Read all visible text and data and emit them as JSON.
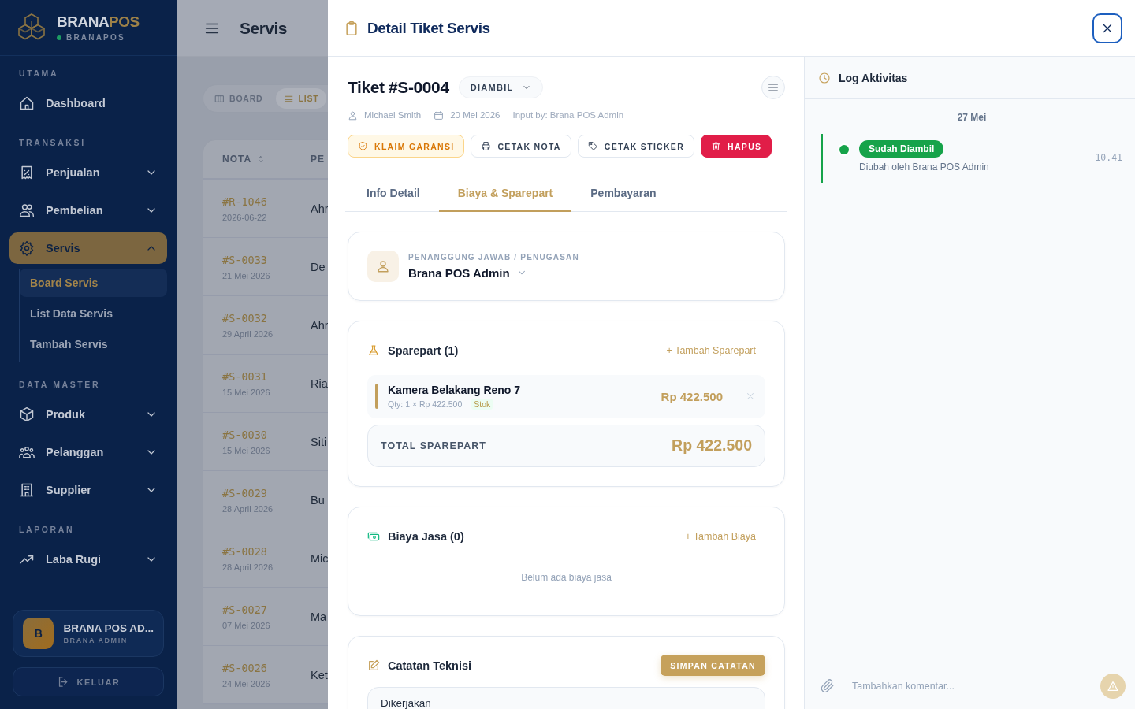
{
  "sidebar": {
    "brand": {
      "name": "BRANA",
      "accent": "POS",
      "subtitle": "BRANAPOS"
    },
    "sections": [
      {
        "label": "UTAMA",
        "items": [
          {
            "label": "Dashboard",
            "selected": false
          }
        ]
      },
      {
        "label": "TRANSAKSI",
        "items": [
          {
            "label": "Penjualan",
            "selected": false,
            "expanded": false
          },
          {
            "label": "Pembelian",
            "selected": false,
            "expanded": false
          },
          {
            "label": "Servis",
            "selected": true,
            "expanded": true,
            "children": [
              {
                "label": "Board Servis",
                "selected": true
              },
              {
                "label": "List Data Servis",
                "selected": false
              },
              {
                "label": "Tambah Servis",
                "selected": false
              }
            ]
          }
        ]
      },
      {
        "label": "DATA MASTER",
        "items": [
          {
            "label": "Produk",
            "selected": false,
            "expanded": false
          },
          {
            "label": "Pelanggan",
            "selected": false,
            "expanded": false
          },
          {
            "label": "Supplier",
            "selected": false,
            "expanded": false
          }
        ]
      },
      {
        "label": "LAPORAN",
        "items": [
          {
            "label": "Laba Rugi",
            "selected": false,
            "expanded": false
          }
        ]
      }
    ],
    "user": {
      "initial": "B",
      "name": "BRANA POS AD...",
      "role": "BRANA ADMIN"
    },
    "logout": "KELUAR"
  },
  "main": {
    "title": "Servis",
    "view_toggle": [
      {
        "label": "BOARD",
        "selected": false
      },
      {
        "label": "LIST",
        "selected": true
      }
    ],
    "table": {
      "columns": [
        "NOTA",
        "PE"
      ],
      "rows": [
        {
          "nota": "#R-1046",
          "date": "2026-06-22",
          "column_2": "Ahr"
        },
        {
          "nota": "#S-0033",
          "date": "21 Mei 2026",
          "column_2": "De"
        },
        {
          "nota": "#S-0032",
          "date": "29 April 2026",
          "column_2": "Ahr"
        },
        {
          "nota": "#S-0031",
          "date": "15 Mei 2026",
          "column_2": "Ria"
        },
        {
          "nota": "#S-0030",
          "date": "15 Mei 2026",
          "column_2": "Siti"
        },
        {
          "nota": "#S-0029",
          "date": "28 April 2026",
          "column_2": "Bu"
        },
        {
          "nota": "#S-0028",
          "date": "28 April 2026",
          "column_2": "Mic"
        },
        {
          "nota": "#S-0027",
          "date": "07 Mei 2026",
          "column_2": "Ma"
        },
        {
          "nota": "#S-0026",
          "date": "24 Mei 2026",
          "column_2": "Ket"
        }
      ]
    }
  },
  "drawer": {
    "title": "Detail Tiket Servis",
    "ticket": {
      "title": "Tiket #S-0004",
      "status": "DIAMBIL",
      "customer": "Michael Smith",
      "date": "20 Mei 2026",
      "input_by": "Input by: Brana POS Admin"
    },
    "actions": [
      {
        "label": "KLAIM GARANSI",
        "kind": "warning"
      },
      {
        "label": "CETAK NOTA",
        "kind": "outline"
      },
      {
        "label": "CETAK STICKER",
        "kind": "outline"
      },
      {
        "label": "HAPUS",
        "kind": "danger"
      }
    ],
    "tabs": [
      {
        "label": "Info Detail",
        "selected": false
      },
      {
        "label": "Biaya & Sparepart",
        "selected": true
      },
      {
        "label": "Pembayaran",
        "selected": false
      }
    ],
    "assignee": {
      "label": "PENANGGUNG JAWAB / PENUGASAN",
      "name": "Brana POS Admin"
    },
    "sparepart": {
      "title": "Sparepart (1)",
      "add": "+ Tambah Sparepart",
      "items": [
        {
          "name": "Kamera Belakang Reno 7",
          "qty": "Qty: 1 × Rp 422.500",
          "tag": "Stok",
          "price": "Rp 422.500"
        }
      ],
      "total_label": "TOTAL SPAREPART",
      "total": "Rp 422.500"
    },
    "service": {
      "title": "Biaya Jasa (0)",
      "add": "+ Tambah Biaya",
      "empty": "Belum ada biaya jasa"
    },
    "notes": {
      "title": "Catatan Teknisi",
      "save": "SIMPAN CATATAN",
      "value": "Dikerjakan"
    },
    "log": {
      "title": "Log Aktivitas",
      "groups": [
        {
          "date": "27 Mei",
          "entries": [
            {
              "status": "Sudah Diambil",
              "color": "#16a34a",
              "by": "Diubah oleh Brana POS Admin",
              "time": "10.41"
            }
          ]
        }
      ]
    },
    "comment": {
      "placeholder": "Tambahkan komentar..."
    }
  }
}
